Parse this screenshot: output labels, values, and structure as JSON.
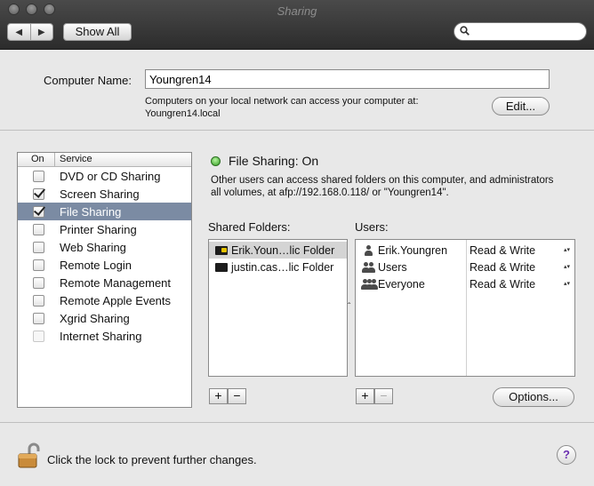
{
  "window": {
    "title": "Sharing"
  },
  "toolbar": {
    "back_glyph": "◀",
    "forward_glyph": "▶",
    "show_all_label": "Show All",
    "search_placeholder": "",
    "search_value": ""
  },
  "computer": {
    "label": "Computer Name:",
    "name_value": "Youngren14",
    "desc_line1": "Computers on your local network can access your computer at:",
    "desc_line2": "Youngren14.local",
    "edit_label": "Edit..."
  },
  "services": {
    "col_on": "On",
    "col_service": "Service",
    "items": [
      {
        "label": "DVD or CD Sharing",
        "checked": false,
        "disabled": false
      },
      {
        "label": "Screen Sharing",
        "checked": true,
        "disabled": false
      },
      {
        "label": "File Sharing",
        "checked": true,
        "disabled": false,
        "selected": true
      },
      {
        "label": "Printer Sharing",
        "checked": false,
        "disabled": false
      },
      {
        "label": "Web Sharing",
        "checked": false,
        "disabled": false
      },
      {
        "label": "Remote Login",
        "checked": false,
        "disabled": false
      },
      {
        "label": "Remote Management",
        "checked": false,
        "disabled": false
      },
      {
        "label": "Remote Apple Events",
        "checked": false,
        "disabled": false
      },
      {
        "label": "Xgrid Sharing",
        "checked": false,
        "disabled": false
      },
      {
        "label": "Internet Sharing",
        "checked": false,
        "disabled": true
      }
    ]
  },
  "file_sharing": {
    "status": "File Sharing: On",
    "status_color": "#2f9a1e",
    "desc_line1": "Other users can access shared folders on this computer, and administrators",
    "desc_line2": "all volumes, at afp://192.168.0.118/ or \"Youngren14\"."
  },
  "shared_folders": {
    "label": "Shared Folders:",
    "items": [
      "Erik.Youn…lic Folder",
      "justin.cas…lic Folder"
    ]
  },
  "users": {
    "label": "Users:",
    "items": [
      {
        "name": "Erik.Youngren",
        "permission": "Read & Write",
        "icon": "single-user-icon"
      },
      {
        "name": "Users",
        "permission": "Read & Write",
        "icon": "group-icon"
      },
      {
        "name": "Everyone",
        "permission": "Read & Write",
        "icon": "everyone-icon"
      }
    ]
  },
  "controls": {
    "plus": "+",
    "minus": "−",
    "options_label": "Options...",
    "splitter_glyph": "ˆ",
    "stepper_glyph": "▴▾"
  },
  "footer": {
    "lock_text": "Click the lock to prevent further changes.",
    "help_glyph": "?"
  }
}
